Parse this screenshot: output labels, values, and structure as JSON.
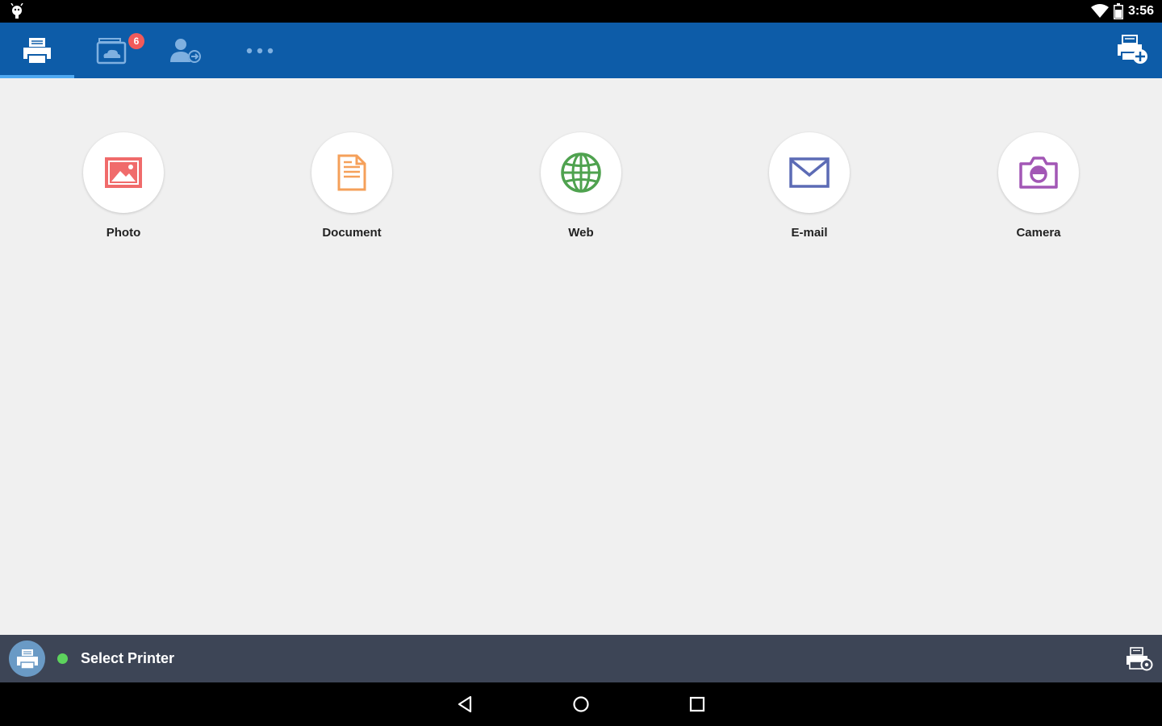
{
  "status_bar": {
    "time": "3:56",
    "left_icon": "android-debug-icon",
    "right_icons": [
      "wifi-icon",
      "battery-icon"
    ]
  },
  "tabs": [
    {
      "name": "print",
      "icon": "printer-icon",
      "active": true
    },
    {
      "name": "cloud",
      "icon": "cloud-photo-icon",
      "badge": "6"
    },
    {
      "name": "account",
      "icon": "account-signin-icon"
    },
    {
      "name": "more",
      "icon": "more-dots-icon"
    }
  ],
  "toolbar": {
    "add_printer_icon": "add-printer-icon"
  },
  "tiles": [
    {
      "label": "Photo",
      "icon": "photo-icon",
      "color": "#f06b6b"
    },
    {
      "label": "Document",
      "icon": "document-icon",
      "color": "#f5a05a"
    },
    {
      "label": "Web",
      "icon": "globe-icon",
      "color": "#4fa24f"
    },
    {
      "label": "E-mail",
      "icon": "envelope-icon",
      "color": "#5c6bb5"
    },
    {
      "label": "Camera",
      "icon": "camera-icon",
      "color": "#a257b5"
    }
  ],
  "bottom_bar": {
    "label": "Select Printer",
    "status_color": "#5dd35d"
  },
  "colors": {
    "app_bar": "#0d5ca8",
    "tab_indicator": "#4fa9f2",
    "badge": "#f15a5a",
    "bottom_bar": "#3d4556",
    "background": "#f0f0f0"
  }
}
